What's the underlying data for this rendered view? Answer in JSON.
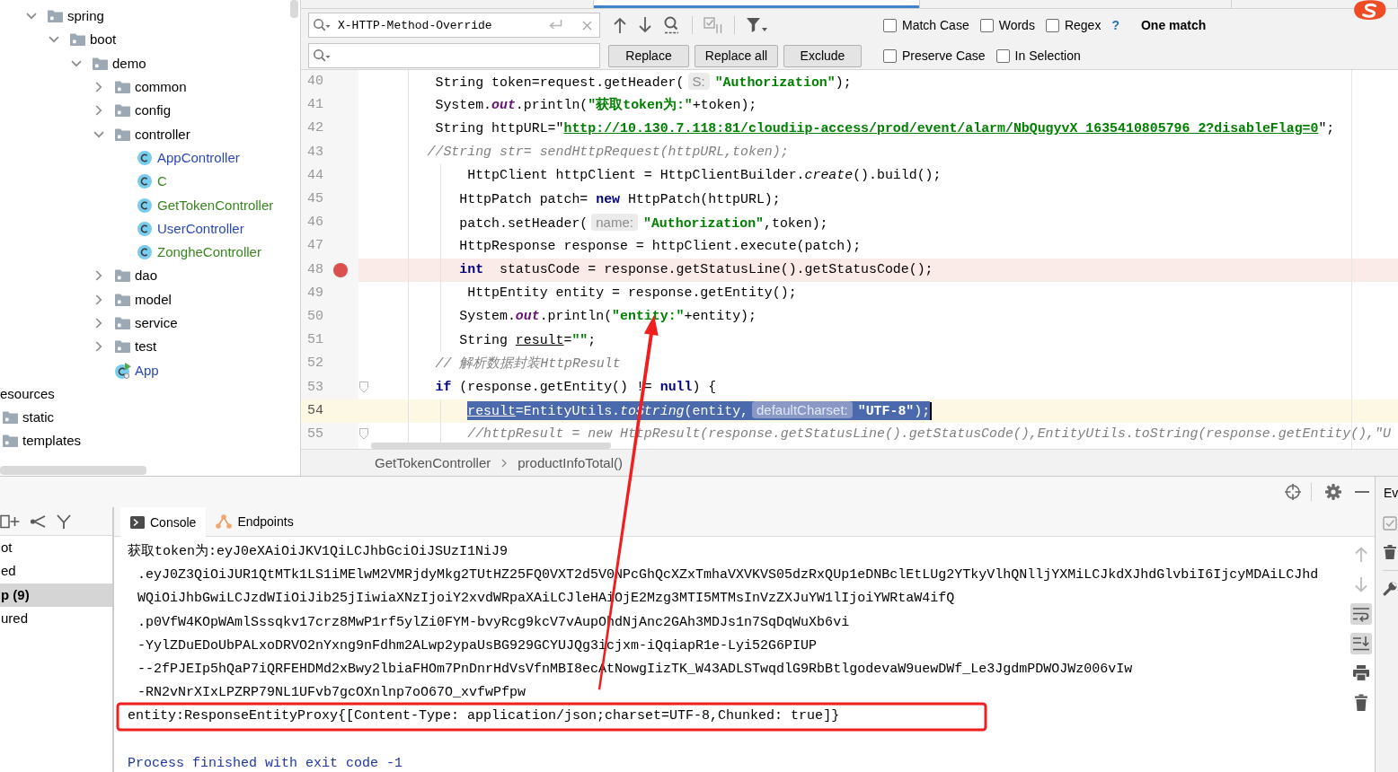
{
  "project_tree": {
    "items": [
      {
        "children": [
          {
            "children": [
              {
                "children": [
                  {
                    "label": "spring",
                    "kind": "package",
                    "expanded": true,
                    "children": [
                      {
                        "label": "boot",
                        "kind": "package",
                        "expanded": true,
                        "children": [
                          {
                            "label": "demo",
                            "kind": "package",
                            "expanded": true,
                            "children": [
                              {
                                "label": "common",
                                "kind": "package",
                                "expanded": false
                              },
                              {
                                "label": "config",
                                "kind": "package",
                                "expanded": false
                              },
                              {
                                "label": "controller",
                                "kind": "package",
                                "expanded": true,
                                "children": [
                                  {
                                    "label": "AppController",
                                    "kind": "class",
                                    "color": "#2a48b5"
                                  },
                                  {
                                    "label": "C",
                                    "kind": "class",
                                    "color": "#3a861f"
                                  },
                                  {
                                    "label": "GetTokenController",
                                    "kind": "class",
                                    "color": "#3a861f"
                                  },
                                  {
                                    "label": "UserController",
                                    "kind": "class",
                                    "color": "#2a48b5"
                                  },
                                  {
                                    "label": "ZongheController",
                                    "kind": "class",
                                    "color": "#3a861f"
                                  }
                                ]
                              },
                              {
                                "label": "dao",
                                "kind": "package",
                                "expanded": false
                              },
                              {
                                "label": "model",
                                "kind": "package",
                                "expanded": false
                              },
                              {
                                "label": "service",
                                "kind": "package",
                                "expanded": false
                              },
                              {
                                "label": "test",
                                "kind": "package",
                                "expanded": false
                              },
                              {
                                "label": "App",
                                "kind": "main-class",
                                "color": "#2a48b5"
                              }
                            ]
                          }
                        ]
                      }
                    ]
                  }
                ]
              }
            ]
          }
        ]
      },
      {
        "label": "esources",
        "children": [
          {
            "label": "static",
            "kind": "package"
          },
          {
            "label": "templates",
            "kind": "package"
          }
        ]
      }
    ]
  },
  "editor": {
    "tabs": [
      {
        "selected": false
      },
      {
        "selected": true
      },
      {
        "selected": false
      },
      {
        "selected": false
      }
    ],
    "find_bar": {
      "search_value": "X-HTTP-Method-Override",
      "search_options": [
        {
          "label": "Match Case",
          "checked": false
        },
        {
          "label": "Words",
          "checked": false
        },
        {
          "label": "Regex",
          "checked": false
        }
      ],
      "help": "?",
      "match_count": "One match",
      "buttons": [
        "Replace",
        "Replace all",
        "Exclude"
      ],
      "replace_options": [
        {
          "label": "Preserve Case",
          "checked": false
        },
        {
          "label": "In Selection",
          "checked": false
        }
      ]
    },
    "lines": [
      {
        "number": "40",
        "breakpoint": false,
        "current": false,
        "selected": false,
        "fold": false,
        "tokens": [
          {
            "kind": "plain",
            "text": "        String token=request.getHeader("
          },
          {
            "kind": "hint",
            "text": "S:"
          },
          {
            "kind": "string",
            "text": "\"Authorization\""
          },
          {
            "kind": "plain",
            "text": ");"
          }
        ]
      },
      {
        "number": "41",
        "breakpoint": false,
        "current": false,
        "selected": false,
        "fold": false,
        "tokens": [
          {
            "kind": "plain",
            "text": "        System."
          },
          {
            "kind": "field",
            "text": "out"
          },
          {
            "kind": "plain",
            "text": ".println("
          },
          {
            "kind": "string",
            "text": "\"获取token为:\""
          },
          {
            "kind": "plain",
            "text": "+token);"
          }
        ]
      },
      {
        "number": "42",
        "breakpoint": false,
        "current": false,
        "selected": false,
        "fold": false,
        "tokens": [
          {
            "kind": "plain",
            "text": "        String httpURL=\""
          },
          {
            "kind": "url",
            "text": "http://10.130.7.118:81/cloudiip-access/prod/event/alarm/NbQugyvX_1635410805796_2?disableFlag=0"
          },
          {
            "kind": "plain",
            "text": "\";"
          }
        ]
      },
      {
        "number": "43",
        "breakpoint": false,
        "current": false,
        "selected": false,
        "fold": false,
        "tokens": [
          {
            "kind": "comment",
            "text": "       //String str= sendHttpRequest(httpURL,token);"
          }
        ]
      },
      {
        "number": "44",
        "breakpoint": false,
        "current": false,
        "selected": false,
        "fold": false,
        "tokens": [
          {
            "kind": "plain",
            "text": "            HttpClient httpClient = HttpClientBuilder."
          },
          {
            "kind": "static",
            "text": "create"
          },
          {
            "kind": "plain",
            "text": "().build();"
          }
        ]
      },
      {
        "number": "45",
        "breakpoint": false,
        "current": false,
        "selected": false,
        "fold": false,
        "tokens": [
          {
            "kind": "plain",
            "text": "           HttpPatch patch= "
          },
          {
            "kind": "keyword",
            "text": "new"
          },
          {
            "kind": "plain",
            "text": " HttpPatch(httpURL);"
          }
        ]
      },
      {
        "number": "46",
        "breakpoint": false,
        "current": false,
        "selected": false,
        "fold": false,
        "tokens": [
          {
            "kind": "plain",
            "text": "           patch.setHeader("
          },
          {
            "kind": "hint",
            "text": "name:"
          },
          {
            "kind": "string",
            "text": "\"Authorization\""
          },
          {
            "kind": "plain",
            "text": ",token);"
          }
        ]
      },
      {
        "number": "47",
        "breakpoint": false,
        "current": false,
        "selected": false,
        "fold": false,
        "tokens": [
          {
            "kind": "plain",
            "text": "           HttpResponse response = httpClient.execute(patch);"
          }
        ]
      },
      {
        "number": "48",
        "breakpoint": true,
        "current": false,
        "selected": false,
        "fold": false,
        "tokens": [
          {
            "kind": "keyword",
            "text": "           int"
          },
          {
            "kind": "plain",
            "text": "  statusCode = response.getStatusLine().getStatusCode();"
          }
        ]
      },
      {
        "number": "49",
        "breakpoint": false,
        "current": false,
        "selected": false,
        "fold": false,
        "tokens": [
          {
            "kind": "plain",
            "text": "            HttpEntity entity = response.getEntity();"
          }
        ]
      },
      {
        "number": "50",
        "breakpoint": false,
        "current": false,
        "selected": false,
        "fold": false,
        "tokens": [
          {
            "kind": "plain",
            "text": "           System."
          },
          {
            "kind": "field",
            "text": "out"
          },
          {
            "kind": "plain",
            "text": ".println("
          },
          {
            "kind": "string",
            "text": "\"entity:\""
          },
          {
            "kind": "plain",
            "text": "+entity);"
          }
        ]
      },
      {
        "number": "51",
        "breakpoint": false,
        "current": false,
        "selected": false,
        "fold": false,
        "tokens": [
          {
            "kind": "plain",
            "text": "           String "
          },
          {
            "kind": "var",
            "text": "result"
          },
          {
            "kind": "plain",
            "text": "="
          },
          {
            "kind": "string",
            "text": "\"\""
          },
          {
            "kind": "plain",
            "text": ";"
          }
        ]
      },
      {
        "number": "52",
        "breakpoint": false,
        "current": false,
        "selected": false,
        "fold": false,
        "tokens": [
          {
            "kind": "comment",
            "text": "        // 解析数据封装HttpResult"
          }
        ]
      },
      {
        "number": "53",
        "breakpoint": false,
        "current": false,
        "selected": false,
        "fold": true,
        "tokens": [
          {
            "kind": "keyword",
            "text": "        if"
          },
          {
            "kind": "plain",
            "text": " (response.getEntity() != "
          },
          {
            "kind": "keyword",
            "text": "null"
          },
          {
            "kind": "plain",
            "text": ") {"
          }
        ]
      },
      {
        "number": "54",
        "breakpoint": false,
        "current": true,
        "selected": true,
        "fold": false,
        "tokens": [
          {
            "kind": "var",
            "text": "            result"
          },
          {
            "kind": "plain",
            "text": "=EntityUtils."
          },
          {
            "kind": "static",
            "text": "toString"
          },
          {
            "kind": "plain",
            "text": "(entity,"
          },
          {
            "kind": "hint",
            "text": "defaultCharset:"
          },
          {
            "kind": "string",
            "text": "\"UTF-8\""
          },
          {
            "kind": "plain",
            "text": ");"
          }
        ]
      },
      {
        "number": "55",
        "breakpoint": false,
        "current": false,
        "selected": false,
        "fold": true,
        "tokens": [
          {
            "kind": "comment",
            "text": "            //httpResult = new HttpResult(response.getStatusLine().getStatusCode(),EntityUtils.toString(response.getEntity(),\"U"
          }
        ]
      }
    ],
    "breadcrumbs": [
      "GetTokenController",
      "productInfoTotal()"
    ]
  },
  "run_panel": {
    "items": [
      {
        "label": "ot",
        "selected": false
      },
      {
        "label": "ed",
        "selected": false
      },
      {
        "label": "p (9)",
        "selected": true
      },
      {
        "label": "ured",
        "selected": false
      }
    ]
  },
  "console": {
    "tabs": [
      {
        "label": "Console",
        "selected": true
      },
      {
        "label": "Endpoints",
        "selected": false
      }
    ],
    "lines": [
      {
        "kind": "output",
        "text": "获取token为:eyJ0eXAiOiJKV1QiLCJhbGciOiJSUzI1NiJ9"
      },
      {
        "kind": "wrapped",
        "text": ".eyJ0Z3QiOiJUR1QtMTk1LS1iMElwM2VMRjdyMkg2TUtHZ25FQ0VXT2d5V0NPcGhQcXZxTmhaVXVKVS05dzRxQUp1eDNBclEtLUg2YTkyVlhQNlljYXMiLCJkdXJhdGlvbiI6IjcyMDAiLCJhd"
      },
      {
        "kind": "wrapped",
        "text": "WQiOiJhbGwiLCJzdWIiOiJib25jIiwiaXNzIjoiY2xvdWRpaXAiLCJleHAiOjE2Mzg3MTI5MTMsInVzZXJuYW1lIjoiYWRtaW4ifQ"
      },
      {
        "kind": "wrapped",
        "text": ".p0VfW4KOpWAmlSssqkv17crz8MwP1rf5ylZi0FYM-bvyRcg9kcV7vAupOhdNjAnc2GAh3MDJs1n7SqDqWuXb6vi"
      },
      {
        "kind": "wrapped",
        "text": "-YylZDuEDoUbPALxoDRVO2nYxng9nFdhm2ALwp2ypaUsBG929GCYUJQg3icjxm-iQqiapR1e-Lyi52G6PIUP"
      },
      {
        "kind": "wrapped",
        "text": "--2fPJEIp5hQaP7iQRFEHDMd2xBwy2lbiaFHOm7PnDnrHdVsVfnMBI8ecAtNowgIizTK_W43ADLSTwqdlG9RbBtlgodevaW9uewDWf_Le3JgdmPDWOJWz006vIw"
      },
      {
        "kind": "wrapped",
        "text": "-RN2vNrXIxLPZRP79NL1UFvb7gcOXnlnp7oO67O_xvfwPfpw"
      },
      {
        "kind": "output",
        "text": "entity:ResponseEntityProxy{[Content-Type: application/json;charset=UTF-8,Chunked: true]}"
      },
      {
        "kind": "blank"
      },
      {
        "kind": "system",
        "text": "Process finished with exit code -1"
      }
    ],
    "toolbar": [
      {
        "kind": "up",
        "on": false,
        "disabled": true
      },
      {
        "kind": "down",
        "on": false,
        "disabled": true
      },
      {
        "kind": "soft-wrap",
        "on": true,
        "disabled": false
      },
      {
        "kind": "scroll-to-end",
        "on": true,
        "disabled": false
      },
      {
        "kind": "print",
        "on": false,
        "disabled": false
      },
      {
        "kind": "clear",
        "on": false,
        "disabled": false
      }
    ]
  },
  "side_strip": {
    "label": "Ev"
  },
  "annotations": [
    {
      "kind": "arrow"
    },
    {
      "kind": "frame"
    }
  ]
}
